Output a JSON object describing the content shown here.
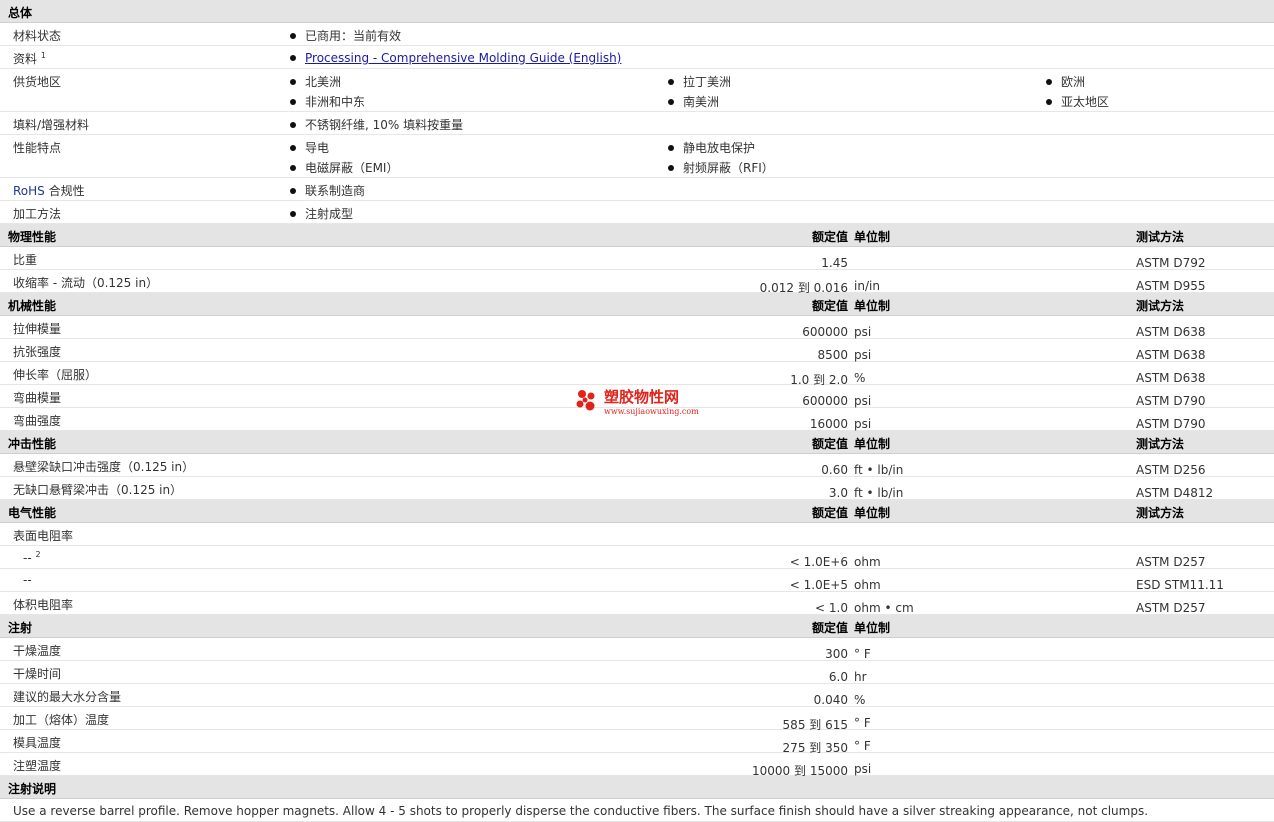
{
  "general": {
    "title": "总体",
    "material_status_label": "材料状态",
    "material_status_value": "已商用：当前有效",
    "literature_label": "资料",
    "literature_sup": "1",
    "literature_link": "Processing - Comprehensive Molding Guide (English)",
    "availability_label": "供货地区",
    "availability": [
      "北美洲",
      "拉丁美洲",
      "欧洲",
      "非洲和中东",
      "南美洲",
      "亚太地区"
    ],
    "filler_label": "填料/增强材料",
    "filler_value": "不锈钢纤维, 10% 填料按重量",
    "features_label": "性能特点",
    "features": [
      "导电",
      "静电放电保护",
      "电磁屏蔽（EMI）",
      "射频屏蔽（RFI）"
    ],
    "rohs_label_a": "RoHS",
    "rohs_label_b": " 合规性",
    "rohs_value": "联系制造商",
    "process_label": "加工方法",
    "process_value": "注射成型"
  },
  "headers": {
    "nominal": "额定值",
    "unit": "单位制",
    "method": "测试方法"
  },
  "physical": {
    "title": "物理性能",
    "rows": [
      {
        "label": "比重",
        "value": "1.45",
        "unit": "",
        "method": "ASTM D792"
      },
      {
        "label": "收缩率 - 流动（0.125 in）",
        "value": "0.012 到 0.016",
        "unit": "in/in",
        "method": "ASTM D955"
      }
    ]
  },
  "mechanical": {
    "title": "机械性能",
    "rows": [
      {
        "label": "拉伸模量",
        "value": "600000",
        "unit": "psi",
        "method": "ASTM D638"
      },
      {
        "label": "抗张强度",
        "value": "8500",
        "unit": "psi",
        "method": "ASTM D638"
      },
      {
        "label": "伸长率（屈服）",
        "value": "1.0 到 2.0",
        "unit": "%",
        "method": "ASTM D638"
      },
      {
        "label": "弯曲模量",
        "value": "600000",
        "unit": "psi",
        "method": "ASTM D790"
      },
      {
        "label": "弯曲强度",
        "value": "16000",
        "unit": "psi",
        "method": "ASTM D790"
      }
    ]
  },
  "impact": {
    "title": "冲击性能",
    "rows": [
      {
        "label": "悬壁梁缺口冲击强度（0.125 in）",
        "value": "0.60",
        "unit": "ft • lb/in",
        "method": "ASTM D256"
      },
      {
        "label": "无缺口悬臂梁冲击（0.125 in）",
        "value": "3.0",
        "unit": "ft • lb/in",
        "method": "ASTM D4812"
      }
    ]
  },
  "electrical": {
    "title": "电气性能",
    "surface_label": "表面电阻率",
    "rows": [
      {
        "label": "--",
        "sup": "2",
        "value": "< 1.0E+6",
        "unit": "ohm",
        "method": "ASTM D257"
      },
      {
        "label": "--",
        "sup": "",
        "value": "< 1.0E+5",
        "unit": "ohm",
        "method": "ESD STM11.11"
      }
    ],
    "volume": {
      "label": "体积电阻率",
      "value": "< 1.0",
      "unit": "ohm • cm",
      "method": "ASTM D257"
    }
  },
  "injection": {
    "title": "注射",
    "rows": [
      {
        "label": "干燥温度",
        "value": "300",
        "unit": "° F"
      },
      {
        "label": "干燥时间",
        "value": "6.0",
        "unit": "hr"
      },
      {
        "label": "建议的最大水分含量",
        "value": "0.040",
        "unit": "%"
      },
      {
        "label": "加工（熔体）温度",
        "value": "585 到 615",
        "unit": "° F"
      },
      {
        "label": "模具温度",
        "value": "275 到 350",
        "unit": "° F"
      },
      {
        "label": "注塑温度",
        "value": "10000 到 15000",
        "unit": "psi"
      }
    ]
  },
  "notes": {
    "title": "注射说明",
    "text": "Use a reverse barrel profile. Remove hopper magnets. Allow 4 - 5 shots to properly disperse the conductive fibers. The surface finish should have a silver streaking appearance, not clumps."
  },
  "watermark": {
    "text": "塑胶物性网",
    "url": "www.sujiaowuxing.com"
  },
  "colors": {
    "section_bg": "#e4e4e4",
    "link": "#1a1aa6",
    "watermark": "#e2231a"
  }
}
